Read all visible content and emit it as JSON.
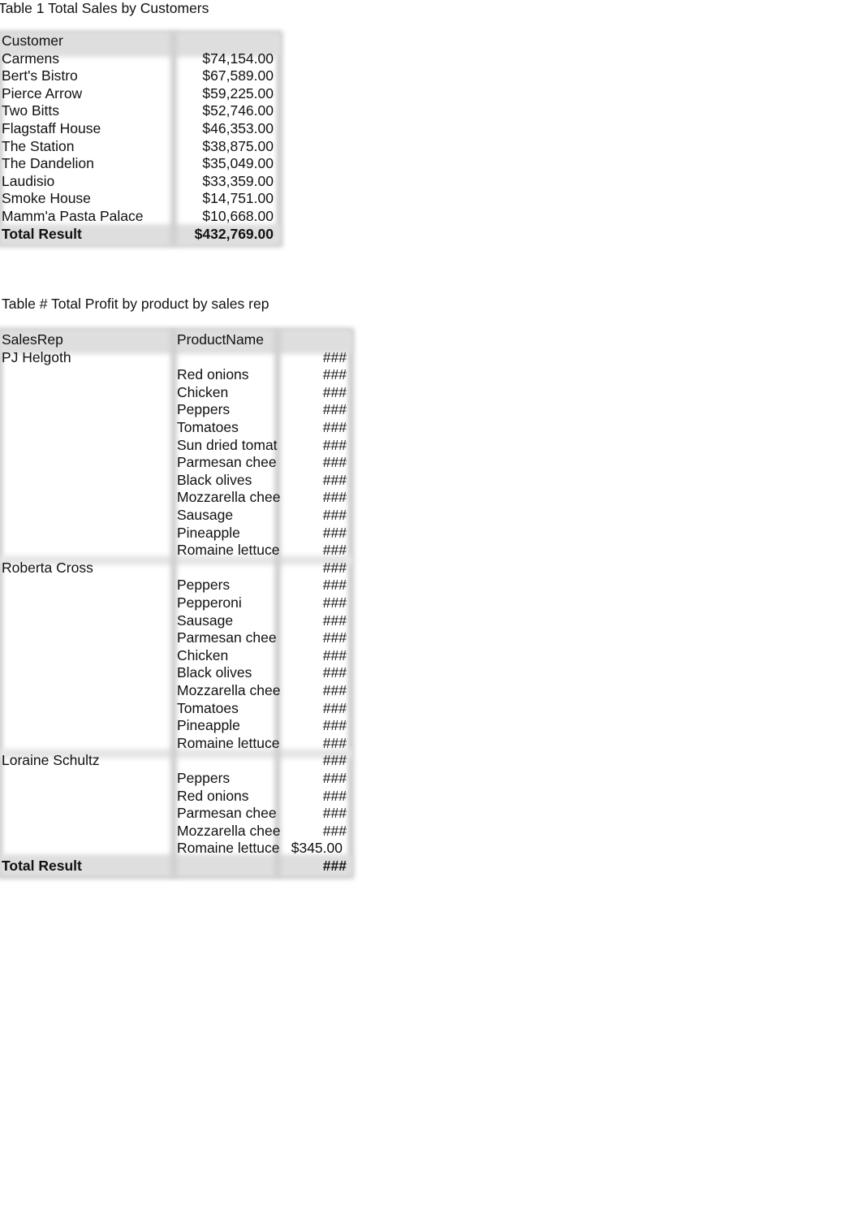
{
  "table1": {
    "caption": "Table 1 Total Sales by Customers",
    "header": {
      "customer": "Customer",
      "value": ""
    },
    "rows": [
      {
        "customer": "Carmens",
        "sales": "$74,154.00"
      },
      {
        "customer": "Bert's Bistro",
        "sales": "$67,589.00"
      },
      {
        "customer": "Pierce Arrow",
        "sales": "$59,225.00"
      },
      {
        "customer": "Two Bitts",
        "sales": "$52,746.00"
      },
      {
        "customer": "Flagstaff House",
        "sales": "$46,353.00"
      },
      {
        "customer": "The Station",
        "sales": "$38,875.00"
      },
      {
        "customer": "The Dandelion",
        "sales": "$35,049.00"
      },
      {
        "customer": "Laudisio",
        "sales": "$33,359.00"
      },
      {
        "customer": "Smoke House",
        "sales": "$14,751.00"
      },
      {
        "customer": "Mamm'a Pasta Palace",
        "sales": "$10,668.00"
      }
    ],
    "total": {
      "label": "Total Result",
      "sales": "$432,769.00"
    }
  },
  "table2": {
    "caption": "Table # Total Profit by product by sales rep",
    "header": {
      "salesrep": "SalesRep",
      "product": "ProductName",
      "value": ""
    },
    "groups": [
      {
        "salesrep": "PJ Helgoth",
        "subtotal": "###",
        "items": [
          {
            "product": "Red onions",
            "value": "###"
          },
          {
            "product": "Chicken",
            "value": "###"
          },
          {
            "product": "Peppers",
            "value": "###"
          },
          {
            "product": "Tomatoes",
            "value": "###"
          },
          {
            "product": "Sun dried tomat",
            "value": "###"
          },
          {
            "product": "Parmesan chee",
            "value": "###"
          },
          {
            "product": "Black olives",
            "value": "###"
          },
          {
            "product": "Mozzarella chee",
            "value": "###"
          },
          {
            "product": "Sausage",
            "value": "###"
          },
          {
            "product": "Pineapple",
            "value": "###"
          },
          {
            "product": "Romaine lettuce",
            "value": "###"
          }
        ]
      },
      {
        "salesrep": "Roberta Cross",
        "subtotal": "###",
        "items": [
          {
            "product": "Peppers",
            "value": "###"
          },
          {
            "product": "Pepperoni",
            "value": "###"
          },
          {
            "product": "Sausage",
            "value": "###"
          },
          {
            "product": "Parmesan chee",
            "value": "###"
          },
          {
            "product": "Chicken",
            "value": "###"
          },
          {
            "product": "Black olives",
            "value": "###"
          },
          {
            "product": "Mozzarella chee",
            "value": "###"
          },
          {
            "product": "Tomatoes",
            "value": "###"
          },
          {
            "product": "Pineapple",
            "value": "###"
          },
          {
            "product": "Romaine lettuce",
            "value": "###"
          }
        ]
      },
      {
        "salesrep": "Loraine Schultz",
        "subtotal": "###",
        "items": [
          {
            "product": "Peppers",
            "value": "###"
          },
          {
            "product": "Red onions",
            "value": "###"
          },
          {
            "product": "Parmesan chee",
            "value": "###"
          },
          {
            "product": "Mozzarella chee",
            "value": "###"
          },
          {
            "product": "Romaine lettuce",
            "value": "$345.00"
          }
        ]
      }
    ],
    "total": {
      "label": "Total Result",
      "value": "###"
    }
  }
}
